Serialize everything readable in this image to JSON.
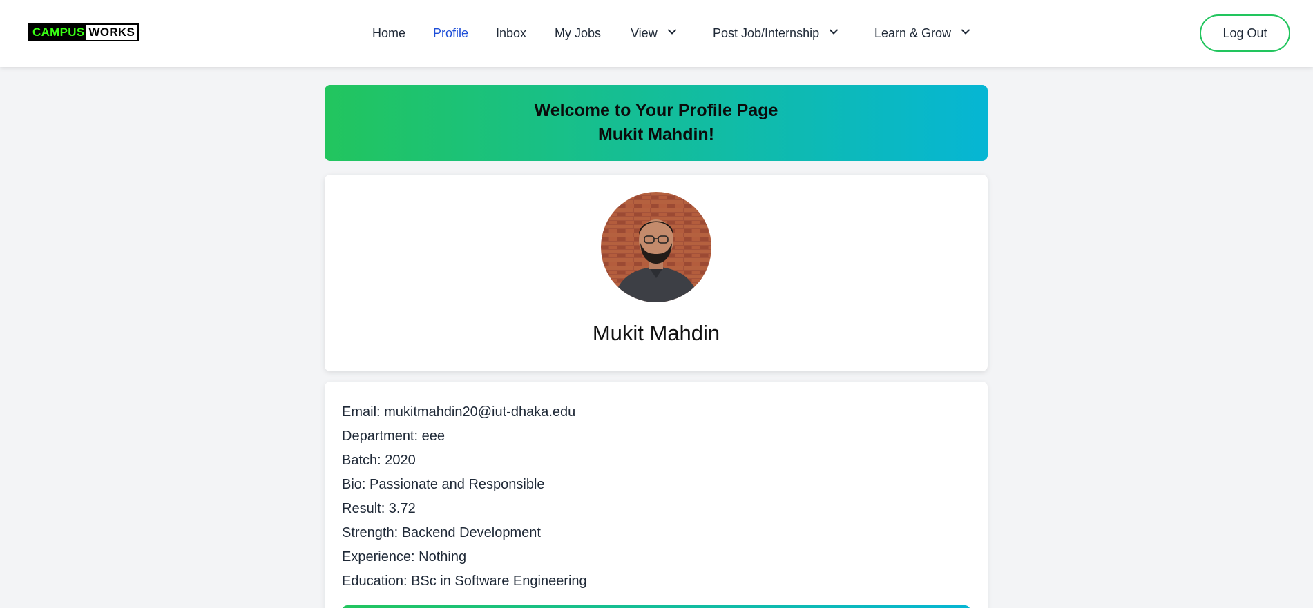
{
  "brand": {
    "logo_part1": "CAMPUS",
    "logo_part2": "WORKS",
    "logo_accent_color": "#39ff14"
  },
  "nav": {
    "items": [
      {
        "label": "Home",
        "active": false,
        "dropdown": false
      },
      {
        "label": "Profile",
        "active": true,
        "dropdown": false
      },
      {
        "label": "Inbox",
        "active": false,
        "dropdown": false
      },
      {
        "label": "My Jobs",
        "active": false,
        "dropdown": false
      },
      {
        "label": "View",
        "active": false,
        "dropdown": true
      },
      {
        "label": "Post Job/Internship",
        "active": false,
        "dropdown": true
      },
      {
        "label": "Learn & Grow",
        "active": false,
        "dropdown": true
      }
    ],
    "logout_label": "Log Out",
    "active_color": "#1d4ed8"
  },
  "banner": {
    "line1": "Welcome to Your Profile Page",
    "line2": "Mukit Mahdin!",
    "gradient_start": "#22c55e",
    "gradient_end": "#06b6d4"
  },
  "profile": {
    "name": "Mukit Mahdin",
    "avatar_icon": "profile-photo"
  },
  "details": [
    "Email: mukitmahdin20@iut-dhaka.edu",
    "Department: eee",
    "Batch: 2020",
    "Bio: Passionate and Responsible",
    "Result: 3.72",
    "Strength: Backend Development",
    "Experience: Nothing",
    "Education: BSc in Software Engineering"
  ]
}
